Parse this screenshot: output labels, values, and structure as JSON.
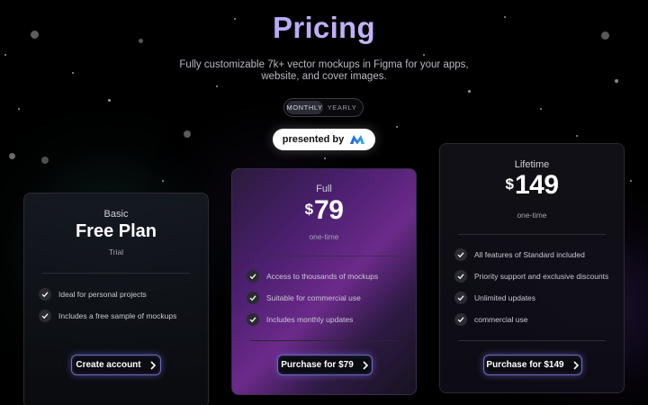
{
  "header": {
    "title": "Pricing",
    "subtitle_line1": "Fully customizable 7k+ vector mockups in Figma for your apps,",
    "subtitle_line2": "website, and cover images."
  },
  "billing_toggle": {
    "options": [
      "MONTHLY",
      "YEARLY"
    ],
    "selected": "MONTHLY"
  },
  "presented_by": {
    "label": "presented by",
    "logo_icon": "brand-m-logo-icon"
  },
  "plans": [
    {
      "name": "Basic",
      "headline": "Free Plan",
      "sub": "Trial",
      "features": [
        "Ideal for personal projects",
        "Includes a free sample of mockups"
      ],
      "cta": "Create account"
    },
    {
      "name": "Full",
      "currency": "$",
      "price": "79",
      "sub": "one-time",
      "features": [
        "Access to thousands of mockups",
        "Suitable for commercial use",
        "Includes monthly updates"
      ],
      "cta": "Purchase for $79"
    },
    {
      "name": "Lifetime",
      "currency": "$",
      "price": "149",
      "sub": "one-time",
      "features": [
        "All features of Standard included",
        "Priority support and exclusive discounts",
        "Unlimited updates",
        "commercial use"
      ],
      "cta": "Purchase for $149"
    }
  ],
  "colors": {
    "accent": "#8f8cf7",
    "button_border": "#6d6ab8",
    "background": "#000000"
  }
}
